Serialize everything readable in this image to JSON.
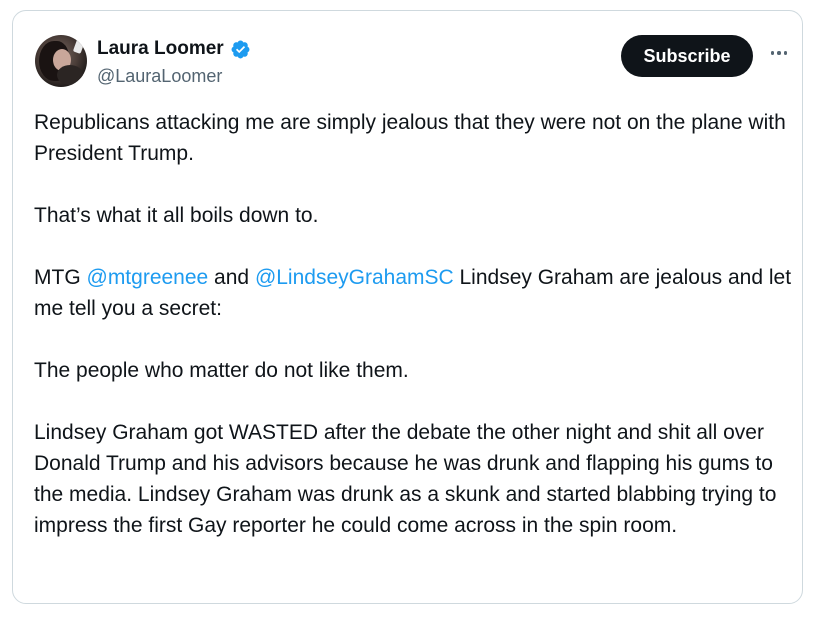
{
  "author": {
    "display_name": "Laura Loomer",
    "handle": "@LauraLoomer",
    "verified": true,
    "verified_icon": "verified-badge-icon",
    "verified_color": "#1d9bf0"
  },
  "actions": {
    "subscribe_label": "Subscribe",
    "more_icon": "more-horizontal-icon"
  },
  "tweet": {
    "p1": "Republicans attacking me are simply jealous that they were not on the plane with President Trump.",
    "p2": "That’s what it all boils down to.",
    "p3_prefix": "MTG ",
    "mention1": "@mtgreenee",
    "p3_mid": " and ",
    "mention2": "@LindseyGrahamSC",
    "p3_suffix": " Lindsey Graham are jealous and let me tell you a secret:",
    "p4": "The people who matter do not like them.",
    "p5": "Lindsey Graham got WASTED after the debate the other night and shit all over Donald Trump and his advisors because he was drunk and flapping his gums to the media. Lindsey Graham was drunk as a skunk and started blabbing trying to impress the first Gay reporter he could come across in the spin room."
  },
  "colors": {
    "link": "#1d9bf0",
    "text": "#0f1419",
    "secondary": "#536471",
    "button_bg": "#0f1419",
    "border": "#cfd9de"
  }
}
